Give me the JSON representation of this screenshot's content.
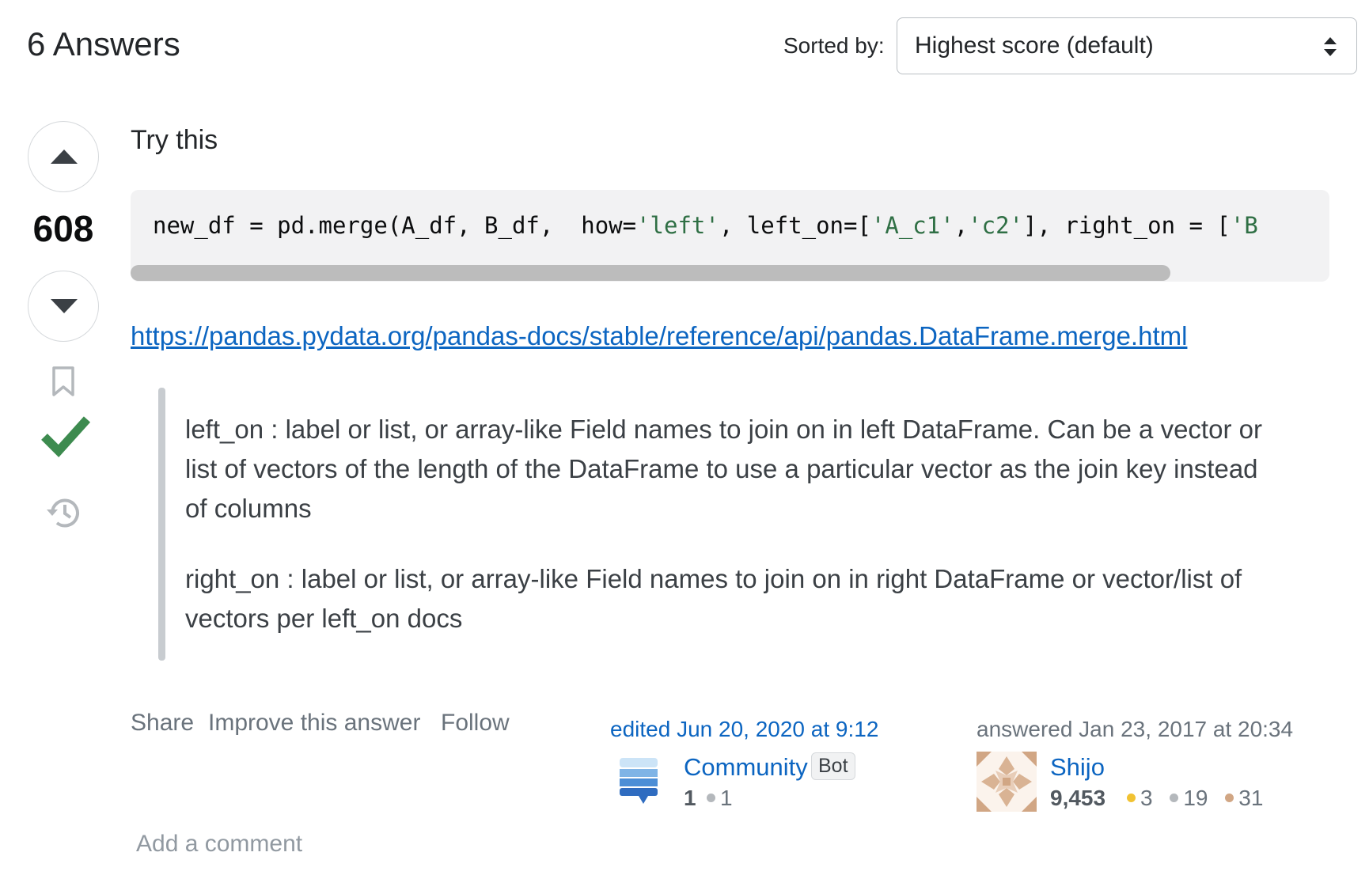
{
  "header": {
    "answers_title": "6 Answers",
    "sort_label": "Sorted by:",
    "sort_value": "Highest score (default)"
  },
  "vote": {
    "count": "608",
    "accepted": true
  },
  "answer": {
    "intro": "Try this",
    "code": {
      "p1": "new_df = pd.merge(A_df, B_df,  how=",
      "s1": "'left'",
      "p2": ", left_on=[",
      "s2": "'A_c1'",
      "p3": ",",
      "s3": "'c2'",
      "p4": "], right_on = [",
      "s4": "'B"
    },
    "link": "https://pandas.pydata.org/pandas-docs/stable/reference/api/pandas.DataFrame.merge.html",
    "quote": [
      "left_on : label or list, or array-like Field names to join on in left DataFrame. Can be a vector or list of vectors of the length of the DataFrame to use a particular vector as the join key instead of columns",
      "right_on : label or list, or array-like Field names to join on in right DataFrame or vector/list of vectors per left_on docs"
    ]
  },
  "post_menu": {
    "share": "Share",
    "improve": "Improve this answer",
    "follow": "Follow"
  },
  "editor": {
    "action_time": "edited Jun 20, 2020 at 9:12",
    "name": "Community",
    "badge": "Bot",
    "reputation": "1",
    "bronze": "1"
  },
  "author": {
    "action_time": "answered Jan 23, 2017 at 20:34",
    "name": "Shijo",
    "reputation": "9,453",
    "gold": "3",
    "silver": "19",
    "bronze": "31"
  },
  "comments": {
    "add": "Add a comment"
  },
  "colors": {
    "link": "#0c65c1",
    "accepted": "#3d8b4f",
    "gold": "#f1c232",
    "silver": "#b4b8bc",
    "bronze": "#d1a684"
  },
  "icons": [
    "chevron-up-icon",
    "chevron-down-icon",
    "bookmark-icon",
    "checkmark-icon",
    "history-icon",
    "sort-arrows-icon"
  ]
}
